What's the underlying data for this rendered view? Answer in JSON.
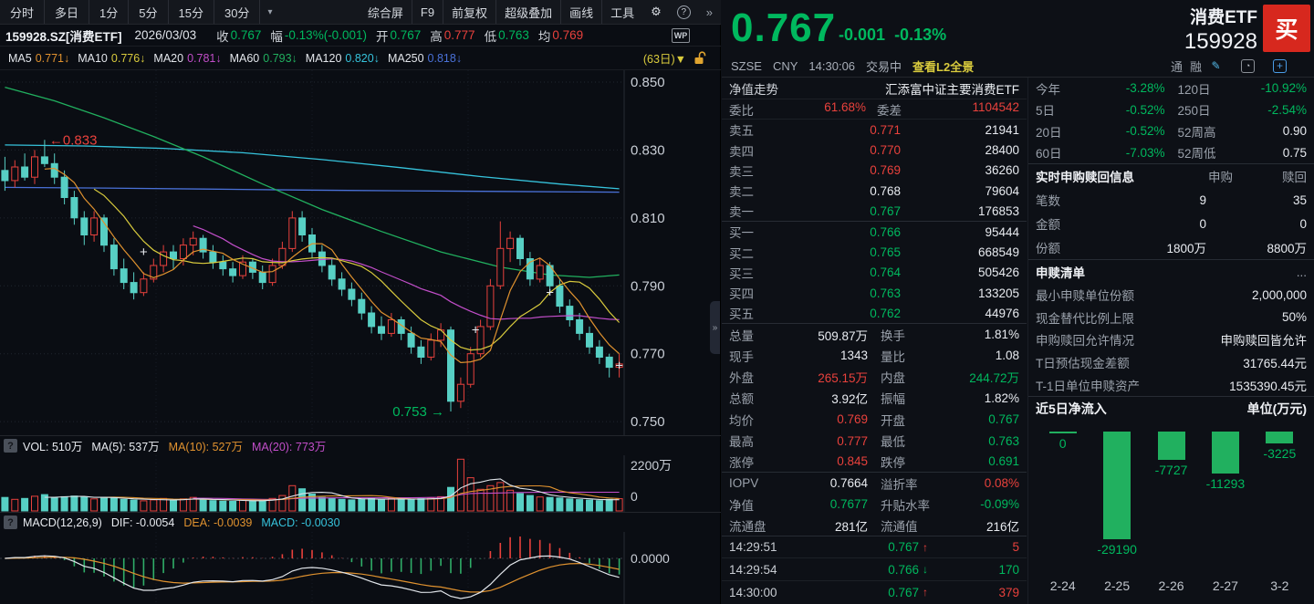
{
  "palette": {
    "green": "#00b85e",
    "red": "#e8413c",
    "yellow": "#d9cb3d",
    "orange": "#e0922f",
    "magenta": "#c24ec9",
    "cyan": "#36c3dc",
    "blue": "#4a71d8",
    "green2": "#21b05f",
    "candledown": "#57cfc4",
    "white": "#e8ebf0",
    "buyred": "#d7281e"
  },
  "toolbar": {
    "periods": [
      "分时",
      "多日",
      "1分",
      "5分",
      "15分",
      "30分"
    ],
    "caret": "▾",
    "tools": [
      "综合屏",
      "F9",
      "前复权",
      "超级叠加",
      "画线",
      "工具"
    ],
    "gear": "⚙",
    "help": "?",
    "more": "»"
  },
  "info_row": {
    "symbol": "159928.SZ[消费ETF]",
    "date": "2026/03/03",
    "fields": [
      {
        "l": "收",
        "v": "0.767",
        "c": "green"
      },
      {
        "l": "幅",
        "v": "-0.13%(-0.001)",
        "c": "green"
      },
      {
        "l": "开",
        "v": "0.767",
        "c": "green"
      },
      {
        "l": "高",
        "v": "0.777",
        "c": "red"
      },
      {
        "l": "低",
        "v": "0.763",
        "c": "green"
      },
      {
        "l": "均",
        "v": "0.769",
        "c": "red"
      }
    ],
    "wp": "WP"
  },
  "ma_row": {
    "items": [
      {
        "l": "MA5",
        "v": "0.771↓",
        "c": "orange"
      },
      {
        "l": "MA10",
        "v": "0.776↓",
        "c": "yellow"
      },
      {
        "l": "MA20",
        "v": "0.781↓",
        "c": "magenta"
      },
      {
        "l": "MA60",
        "v": "0.793↓",
        "c": "green2"
      },
      {
        "l": "MA120",
        "v": "0.820↓",
        "c": "cyan"
      },
      {
        "l": "MA250",
        "v": "0.818↓",
        "c": "blue"
      }
    ],
    "period": "(63日)▼"
  },
  "vol_header": {
    "q": "?",
    "items": [
      {
        "t": "VOL: 510万",
        "c": "white"
      },
      {
        "t": "MA(5): 537万",
        "c": "white"
      },
      {
        "t": "MA(10): 527万",
        "c": "orange"
      },
      {
        "t": "MA(20): 773万",
        "c": "magenta"
      }
    ]
  },
  "macd_header": {
    "q": "?",
    "title": "MACD(12,26,9)",
    "items": [
      {
        "t": "DIF: -0.0054",
        "c": "white"
      },
      {
        "t": "DEA: -0.0039",
        "c": "orange"
      },
      {
        "t": "MACD: -0.0030",
        "c": "cyan"
      }
    ]
  },
  "quote": {
    "price": "0.767",
    "change": "-0.001",
    "pct": "-0.13%",
    "name": "消费ETF",
    "code": "159928",
    "buy": "买",
    "exchange": "SZSE",
    "currency": "CNY",
    "time": "14:30:06",
    "status": "交易中",
    "l2_link": "查看L2全景",
    "margin1": "通",
    "margin2": "融",
    "edit_icon": "✎",
    "add_icon": "+"
  },
  "order_book": {
    "nav_label": "净值走势",
    "nav_value": "汇添富中证主要消费ETF",
    "ratio_row": {
      "l1": "委比",
      "v1": "61.68%",
      "l2": "委差",
      "v2": "1104542"
    },
    "asks": [
      {
        "label": "卖五",
        "price": "0.771",
        "pc": "red",
        "vol": "21941"
      },
      {
        "label": "卖四",
        "price": "0.770",
        "pc": "red",
        "vol": "28400"
      },
      {
        "label": "卖三",
        "price": "0.769",
        "pc": "red",
        "vol": "36260"
      },
      {
        "label": "卖二",
        "price": "0.768",
        "pc": "white",
        "vol": "79604"
      },
      {
        "label": "卖一",
        "price": "0.767",
        "pc": "green",
        "vol": "176853"
      }
    ],
    "bids": [
      {
        "label": "买一",
        "price": "0.766",
        "pc": "green",
        "vol": "95444"
      },
      {
        "label": "买二",
        "price": "0.765",
        "pc": "green",
        "vol": "668549"
      },
      {
        "label": "买三",
        "price": "0.764",
        "pc": "green",
        "vol": "505426"
      },
      {
        "label": "买四",
        "price": "0.763",
        "pc": "green",
        "vol": "133205"
      },
      {
        "label": "买五",
        "price": "0.762",
        "pc": "green",
        "vol": "44976"
      }
    ]
  },
  "stats_rows": [
    [
      {
        "l": "总量",
        "v": "509.87万",
        "c": "white"
      },
      {
        "l": "换手",
        "v": "1.81%",
        "c": "white"
      }
    ],
    [
      {
        "l": "现手",
        "v": "1343",
        "c": "white"
      },
      {
        "l": "量比",
        "v": "1.08",
        "c": "white"
      }
    ],
    [
      {
        "l": "外盘",
        "v": "265.15万",
        "c": "red"
      },
      {
        "l": "内盘",
        "v": "244.72万",
        "c": "green"
      }
    ],
    [
      {
        "l": "总额",
        "v": "3.92亿",
        "c": "white"
      },
      {
        "l": "振幅",
        "v": "1.82%",
        "c": "white"
      }
    ],
    [
      {
        "l": "均价",
        "v": "0.769",
        "c": "red"
      },
      {
        "l": "开盘",
        "v": "0.767",
        "c": "green"
      }
    ],
    [
      {
        "l": "最高",
        "v": "0.777",
        "c": "red"
      },
      {
        "l": "最低",
        "v": "0.763",
        "c": "green"
      }
    ],
    [
      {
        "l": "涨停",
        "v": "0.845",
        "c": "red"
      },
      {
        "l": "跌停",
        "v": "0.691",
        "c": "green"
      }
    ],
    [
      {
        "l": "IOPV",
        "v": "0.7664",
        "c": "white"
      },
      {
        "l": "溢折率",
        "v": "0.08%",
        "c": "red"
      }
    ],
    [
      {
        "l": "净值",
        "v": "0.7677",
        "c": "green"
      },
      {
        "l": "升贴水率",
        "v": "-0.09%",
        "c": "green"
      }
    ],
    [
      {
        "l": "流通盘",
        "v": "281亿",
        "c": "white"
      },
      {
        "l": "流通值",
        "v": "216亿",
        "c": "white"
      }
    ]
  ],
  "ticks": [
    {
      "time": "14:29:51",
      "price": "0.767",
      "dir": "up",
      "vol": "5"
    },
    {
      "time": "14:29:54",
      "price": "0.766",
      "dir": "down",
      "vol": "170"
    },
    {
      "time": "14:30:00",
      "price": "0.767",
      "dir": "up",
      "vol": "379"
    }
  ],
  "perf_rows": [
    [
      {
        "l": "今年",
        "v": "-3.28%",
        "c": "green"
      },
      {
        "l": "120日",
        "v": "-10.92%",
        "c": "green"
      }
    ],
    [
      {
        "l": "5日",
        "v": "-0.52%",
        "c": "green"
      },
      {
        "l": "250日",
        "v": "-2.54%",
        "c": "green"
      }
    ],
    [
      {
        "l": "20日",
        "v": "-0.52%",
        "c": "green"
      },
      {
        "l": "52周高",
        "v": "0.90",
        "c": "white"
      }
    ],
    [
      {
        "l": "60日",
        "v": "-7.03%",
        "c": "green"
      },
      {
        "l": "52周低",
        "v": "0.75",
        "c": "white"
      }
    ]
  ],
  "subscription": {
    "title": "实时申购赎回信息",
    "col1": "申购",
    "col2": "赎回",
    "rows": [
      {
        "l": "笔数",
        "v1": "9",
        "v2": "35"
      },
      {
        "l": "金额",
        "v1": "0",
        "v2": "0"
      },
      {
        "l": "份额",
        "v1": "1800万",
        "v2": "8800万"
      }
    ]
  },
  "redeem": {
    "title": "申赎清单",
    "more": "...",
    "rows": [
      {
        "l": "最小申赎单位份额",
        "v": "2,000,000"
      },
      {
        "l": "现金替代比例上限",
        "v": "50%"
      },
      {
        "l": "申购赎回允许情况",
        "v": "申购赎回皆允许"
      },
      {
        "l": "T日预估现金差额",
        "v": "31765.44元"
      },
      {
        "l": "T-1日单位申赎资产",
        "v": "1535390.45元"
      }
    ]
  },
  "chart_data": [
    {
      "type": "candlestick",
      "title": "159928.SZ 消费ETF 日K (63日)",
      "ylim": [
        0.746,
        0.8535
      ],
      "y_ticks": [
        0.85,
        0.83,
        0.81,
        0.79,
        0.77,
        0.75
      ],
      "grid": true,
      "candles": [
        [
          0.824,
          0.828,
          0.818,
          0.821
        ],
        [
          0.821,
          0.827,
          0.819,
          0.825
        ],
        [
          0.825,
          0.829,
          0.821,
          0.822
        ],
        [
          0.822,
          0.83,
          0.82,
          0.828
        ],
        [
          0.828,
          0.833,
          0.825,
          0.826
        ],
        [
          0.826,
          0.829,
          0.82,
          0.822
        ],
        [
          0.822,
          0.824,
          0.814,
          0.816
        ],
        [
          0.816,
          0.818,
          0.808,
          0.81
        ],
        [
          0.81,
          0.812,
          0.802,
          0.805
        ],
        [
          0.805,
          0.812,
          0.803,
          0.81
        ],
        [
          0.81,
          0.811,
          0.8,
          0.802
        ],
        [
          0.802,
          0.804,
          0.793,
          0.795
        ],
        [
          0.795,
          0.798,
          0.789,
          0.791
        ],
        [
          0.791,
          0.794,
          0.786,
          0.788
        ],
        [
          0.788,
          0.794,
          0.787,
          0.792
        ],
        [
          0.792,
          0.798,
          0.791,
          0.796
        ],
        [
          0.796,
          0.802,
          0.794,
          0.8
        ],
        [
          0.8,
          0.802,
          0.795,
          0.798
        ],
        [
          0.798,
          0.804,
          0.796,
          0.802
        ],
        [
          0.802,
          0.806,
          0.799,
          0.804
        ],
        [
          0.804,
          0.805,
          0.798,
          0.8
        ],
        [
          0.8,
          0.802,
          0.795,
          0.797
        ],
        [
          0.797,
          0.799,
          0.793,
          0.795
        ],
        [
          0.795,
          0.797,
          0.791,
          0.793
        ],
        [
          0.793,
          0.799,
          0.792,
          0.797
        ],
        [
          0.797,
          0.798,
          0.792,
          0.794
        ],
        [
          0.794,
          0.796,
          0.789,
          0.791
        ],
        [
          0.791,
          0.798,
          0.79,
          0.796
        ],
        [
          0.796,
          0.803,
          0.795,
          0.801
        ],
        [
          0.801,
          0.812,
          0.8,
          0.81
        ],
        [
          0.81,
          0.812,
          0.803,
          0.805
        ],
        [
          0.805,
          0.807,
          0.798,
          0.8
        ],
        [
          0.8,
          0.802,
          0.794,
          0.796
        ],
        [
          0.796,
          0.798,
          0.79,
          0.792
        ],
        [
          0.792,
          0.794,
          0.787,
          0.789
        ],
        [
          0.789,
          0.791,
          0.784,
          0.786
        ],
        [
          0.786,
          0.788,
          0.78,
          0.782
        ],
        [
          0.782,
          0.784,
          0.776,
          0.778
        ],
        [
          0.778,
          0.781,
          0.774,
          0.776
        ],
        [
          0.776,
          0.782,
          0.775,
          0.78
        ],
        [
          0.78,
          0.781,
          0.774,
          0.776
        ],
        [
          0.776,
          0.778,
          0.77,
          0.772
        ],
        [
          0.772,
          0.774,
          0.767,
          0.769
        ],
        [
          0.769,
          0.776,
          0.768,
          0.774
        ],
        [
          0.774,
          0.779,
          0.772,
          0.777
        ],
        [
          0.777,
          0.778,
          0.753,
          0.756
        ],
        [
          0.756,
          0.763,
          0.754,
          0.761
        ],
        [
          0.761,
          0.772,
          0.76,
          0.77
        ],
        [
          0.77,
          0.78,
          0.769,
          0.778
        ],
        [
          0.778,
          0.792,
          0.777,
          0.79
        ],
        [
          0.79,
          0.809,
          0.789,
          0.801
        ],
        [
          0.801,
          0.806,
          0.797,
          0.804
        ],
        [
          0.804,
          0.805,
          0.796,
          0.798
        ],
        [
          0.798,
          0.8,
          0.79,
          0.792
        ],
        [
          0.792,
          0.798,
          0.791,
          0.796
        ],
        [
          0.796,
          0.797,
          0.788,
          0.79
        ],
        [
          0.79,
          0.792,
          0.782,
          0.784
        ],
        [
          0.784,
          0.786,
          0.778,
          0.78
        ],
        [
          0.78,
          0.782,
          0.774,
          0.776
        ],
        [
          0.776,
          0.778,
          0.77,
          0.772
        ],
        [
          0.772,
          0.774,
          0.767,
          0.769
        ],
        [
          0.769,
          0.77,
          0.763,
          0.766
        ],
        [
          0.766,
          0.77,
          0.763,
          0.767
        ]
      ],
      "volumes": [
        560,
        480,
        520,
        610,
        680,
        540,
        590,
        620,
        580,
        500,
        530,
        560,
        480,
        450,
        420,
        460,
        520,
        440,
        500,
        560,
        480,
        430,
        410,
        400,
        460,
        420,
        440,
        520,
        640,
        1050,
        920,
        700,
        560,
        520,
        480,
        460,
        500,
        540,
        470,
        520,
        460,
        480,
        510,
        550,
        590,
        980,
        2150,
        1380,
        900,
        1050,
        1180,
        860,
        720,
        640,
        580,
        560,
        540,
        500,
        470,
        450,
        430,
        480,
        510
      ],
      "vol_axis": [
        "2200万",
        "0"
      ],
      "vol_max": 2200,
      "macd_zero_label": "0.0000",
      "ma_overlays": {
        "ma60": [
          [
            0,
            0.8485
          ],
          [
            5,
            0.8445
          ],
          [
            10,
            0.8395
          ],
          [
            15,
            0.834
          ],
          [
            20,
            0.828
          ],
          [
            26,
            0.82
          ],
          [
            32,
            0.8125
          ],
          [
            38,
            0.806
          ],
          [
            44,
            0.8
          ],
          [
            50,
            0.7955
          ],
          [
            55,
            0.7932
          ],
          [
            59,
            0.7925
          ],
          [
            62,
            0.7932
          ]
        ],
        "ma120": [
          [
            0,
            0.8315
          ],
          [
            8,
            0.8312
          ],
          [
            16,
            0.8305
          ],
          [
            24,
            0.8292
          ],
          [
            32,
            0.8272
          ],
          [
            40,
            0.8248
          ],
          [
            48,
            0.8222
          ],
          [
            56,
            0.82
          ],
          [
            62,
            0.8186
          ]
        ],
        "ma250": [
          [
            0,
            0.819
          ],
          [
            10,
            0.8188
          ],
          [
            20,
            0.8185
          ],
          [
            30,
            0.8182
          ],
          [
            40,
            0.818
          ],
          [
            50,
            0.8178
          ],
          [
            62,
            0.8176
          ]
        ]
      },
      "annotations": {
        "high": {
          "idx": 4,
          "price": 0.833,
          "text": "←0.833"
        },
        "low": {
          "idx": 45,
          "price": 0.753,
          "text": "0.753 →"
        },
        "marker_glyph": "+",
        "markers": [
          [
            14,
            0.8
          ],
          [
            47.5,
            0.777
          ],
          [
            55,
            0.788
          ],
          [
            62,
            0.7665
          ]
        ]
      }
    },
    {
      "type": "bar",
      "title": "近5日净流入",
      "unit": "单位(万元)",
      "categories": [
        "2-24",
        "2-25",
        "2-26",
        "2-27",
        "3-2"
      ],
      "values": [
        0,
        -29190,
        -7727,
        -11293,
        -3225
      ],
      "zero_label": "0",
      "bar_color": "#21b05f",
      "ylim": [
        -29190,
        0
      ]
    }
  ]
}
